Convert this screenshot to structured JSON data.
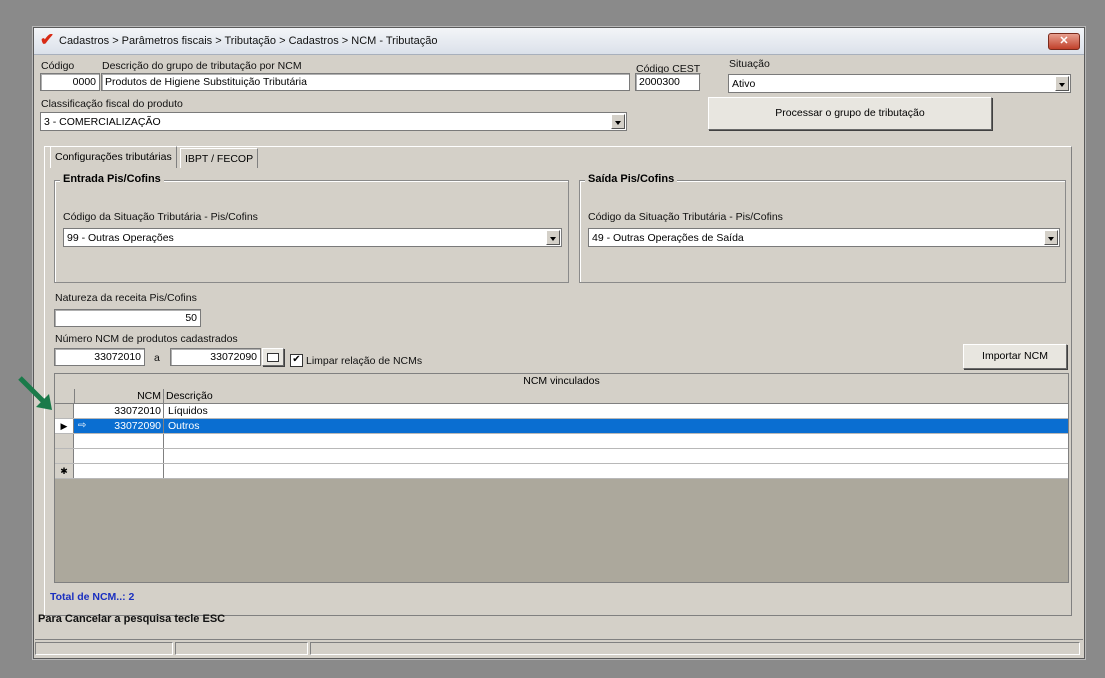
{
  "window": {
    "title": "Cadastros > Parâmetros fiscais > Tributação > Cadastros > NCM - Tributação",
    "close_label": "✕"
  },
  "form": {
    "codigo_label": "Código",
    "codigo_value": "0000",
    "descricao_label": "Descrição do grupo de tributação por NCM",
    "descricao_value": "Produtos de Higiene Substituição Tributária",
    "cest_label": "Código CEST",
    "cest_value": "2000300",
    "situacao_label": "Situação",
    "situacao_value": "Ativo",
    "classificacao_label": "Classificação fiscal do produto",
    "classificacao_value": "3 - COMERCIALIZAÇÃO",
    "processar_label": "Processar o grupo de tributação"
  },
  "tabs": [
    {
      "label": "Configurações tributárias"
    },
    {
      "label": "IBPT / FECOP"
    }
  ],
  "entrada": {
    "title": "Entrada Pis/Cofins",
    "cst_label": "Código da Situação Tributária - Pis/Cofins",
    "cst_value": "99 - Outras Operações"
  },
  "saida": {
    "title": "Saída Pis/Cofins",
    "cst_label": "Código da Situação Tributária - Pis/Cofins",
    "cst_value": "49 - Outras Operações de Saída"
  },
  "natureza": {
    "label": "Natureza da receita Pis/Cofins",
    "value": "50"
  },
  "ncm_range": {
    "label": "Número NCM de produtos cadastrados",
    "from": "33072010",
    "sep": "a",
    "to": "33072090",
    "limpar_label": "Limpar relação de NCMs",
    "limpar_checked": true,
    "importar_label": "Importar NCM"
  },
  "grid": {
    "caption": "NCM vinculados",
    "col_ncm": "NCM",
    "col_desc": "Descrição",
    "rows": [
      {
        "ncm": "33072010",
        "desc": "Líquidos"
      },
      {
        "ncm": "33072090",
        "desc": "Outros"
      }
    ],
    "new_row_marker": "✱"
  },
  "total": "Total de NCM..: 2",
  "status_text": "Para Cancelar a pesquisa tecle ESC",
  "colors": {
    "selection": "#0a6ed1",
    "total_text": "#1a2fc0",
    "annotation_arrow": "#1a7a4a"
  }
}
